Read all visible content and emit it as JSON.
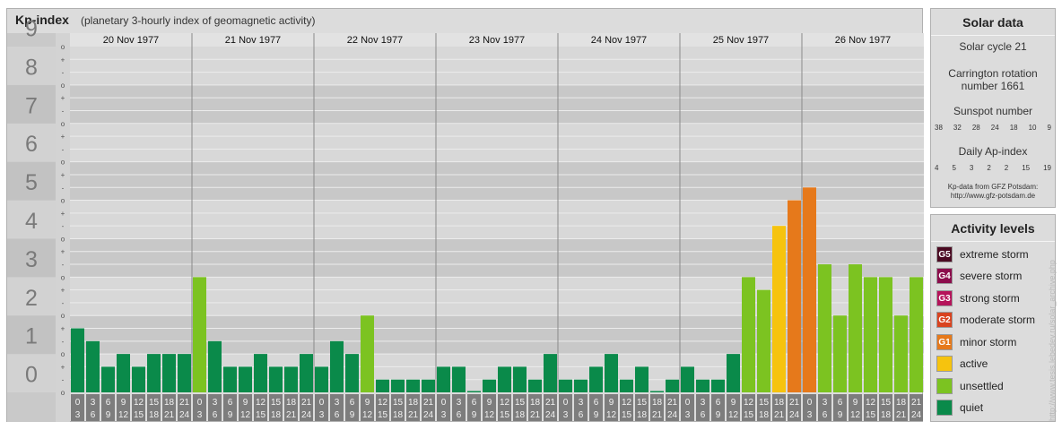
{
  "header": {
    "title": "Kp-index",
    "subtitle": "(planetary 3-hourly index of geomagnetic activity)"
  },
  "colors": {
    "quiet": "#0a8a4a",
    "unsettled": "#7cc321",
    "active": "#f6c30e",
    "minor_storm": "#e6791b",
    "moderate_storm": "#d9431f",
    "strong_storm": "#b5135a",
    "severe_storm": "#8c0d4c",
    "extreme_storm": "#4a0a22"
  },
  "chart_data": {
    "type": "bar",
    "title": "Kp-index",
    "ylim": [
      0,
      9
    ],
    "y_tick_labels": [
      "0",
      "1",
      "2",
      "3",
      "4",
      "5",
      "6",
      "7",
      "8",
      "9"
    ],
    "minor_tick_labels": [
      "o",
      "-",
      "+",
      "o"
    ],
    "days": [
      "20 Nov 1977",
      "21 Nov 1977",
      "22 Nov 1977",
      "23 Nov 1977",
      "24 Nov 1977",
      "25 Nov 1977",
      "26 Nov 1977"
    ],
    "hour_labels_top": [
      "0",
      "3",
      "6",
      "9",
      "12",
      "15",
      "18",
      "21"
    ],
    "hour_labels_bottom": [
      "3",
      "6",
      "9",
      "12",
      "15",
      "18",
      "21",
      "24"
    ],
    "values": [
      1.667,
      1.333,
      0.667,
      1.0,
      0.667,
      1.0,
      1.0,
      1.0,
      3.0,
      1.333,
      0.667,
      0.667,
      1.0,
      0.667,
      0.667,
      1.0,
      0.667,
      1.333,
      1.0,
      2.0,
      0.333,
      0.333,
      0.333,
      0.333,
      0.667,
      0.667,
      0.0,
      0.333,
      0.667,
      0.667,
      0.333,
      1.0,
      0.333,
      0.333,
      0.667,
      1.0,
      0.333,
      0.667,
      0.0,
      0.333,
      0.667,
      0.333,
      0.333,
      1.0,
      3.0,
      2.667,
      4.333,
      5.0,
      5.333,
      3.333,
      2.0,
      3.333,
      3.0,
      3.0,
      2.0,
      3.0
    ]
  },
  "solar": {
    "title": "Solar data",
    "cycle": "Solar cycle 21",
    "carrington_1": "Carrington rotation",
    "carrington_2": "number 1661",
    "sunspot_title": "Sunspot number",
    "sunspots": [
      "38",
      "32",
      "28",
      "24",
      "18",
      "10",
      "9"
    ],
    "ap_title": "Daily Ap-index",
    "ap": [
      "4",
      "5",
      "3",
      "2",
      "2",
      "15",
      "19"
    ],
    "credit_1": "Kp-data from GFZ Potsdam:",
    "credit_2": "http://www.gfz-potsdam.de"
  },
  "legend": {
    "title": "Activity levels",
    "items": [
      {
        "code": "G5",
        "label": "extreme storm",
        "color": "#4a0a22"
      },
      {
        "code": "G4",
        "label": "severe storm",
        "color": "#8c0d4c"
      },
      {
        "code": "G3",
        "label": "strong storm",
        "color": "#b5135a"
      },
      {
        "code": "G2",
        "label": "moderate storm",
        "color": "#d9431f"
      },
      {
        "code": "G1",
        "label": "minor storm",
        "color": "#e6791b"
      },
      {
        "code": "",
        "label": "active",
        "color": "#f6c30e"
      },
      {
        "code": "",
        "label": "unsettled",
        "color": "#7cc321"
      },
      {
        "code": "",
        "label": "quiet",
        "color": "#0a8a4a"
      }
    ]
  },
  "watermark": "http://www.tesis.lebedev.ru/solar_archive.php"
}
